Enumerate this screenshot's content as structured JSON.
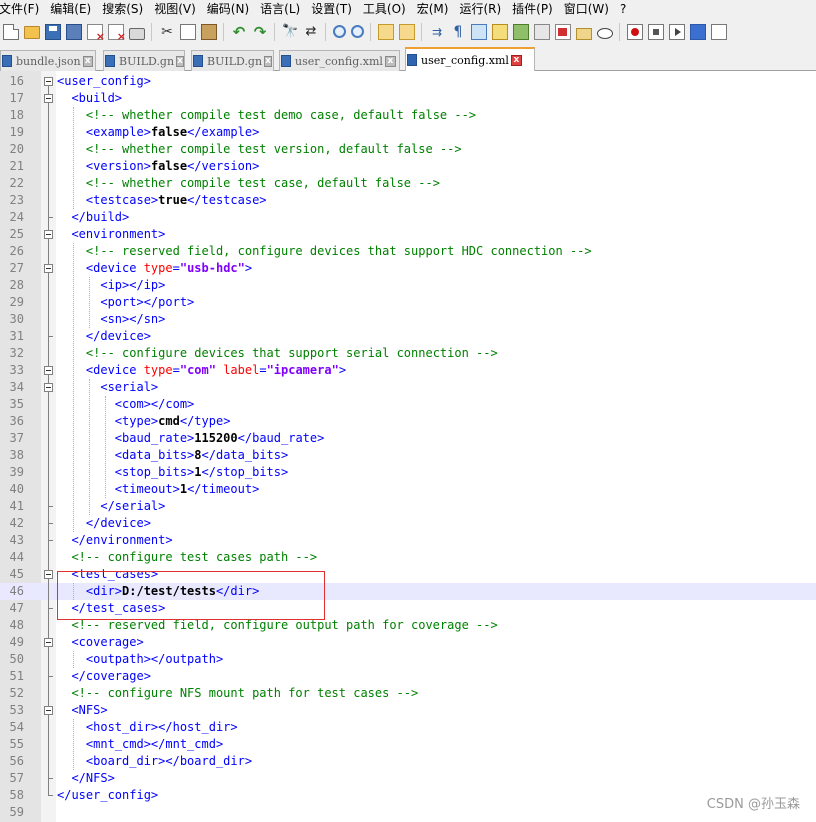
{
  "menu": [
    "文件(F)",
    "编辑(E)",
    "搜索(S)",
    "视图(V)",
    "编码(N)",
    "语言(L)",
    "设置(T)",
    "工具(O)",
    "宏(M)",
    "运行(R)",
    "插件(P)",
    "窗口(W)",
    "?"
  ],
  "tabs": [
    {
      "label": "bundle.json",
      "close": "x",
      "active": false
    },
    {
      "label": "BUILD.gn",
      "close": "x",
      "active": false
    },
    {
      "label": "BUILD.gn",
      "close": "x",
      "active": false
    },
    {
      "label": "user_config.xml",
      "close": "x",
      "active": false
    },
    {
      "label": "user_config.xml",
      "close": "x",
      "active": true
    }
  ],
  "lines": [
    {
      "n": "16",
      "html": "<span class=\"tag\">&lt;user_config&gt;</span>"
    },
    {
      "n": "17",
      "html": "  <span class=\"tag\">&lt;build&gt;</span>"
    },
    {
      "n": "18",
      "html": "    <span class=\"cmt\">&lt;!-- whether compile test demo case, default false --&gt;</span>"
    },
    {
      "n": "19",
      "html": "    <span class=\"tag\">&lt;example&gt;</span><span class=\"txt\">false</span><span class=\"tag\">&lt;/example&gt;</span>"
    },
    {
      "n": "20",
      "html": "    <span class=\"cmt\">&lt;!-- whether compile test version, default false --&gt;</span>"
    },
    {
      "n": "21",
      "html": "    <span class=\"tag\">&lt;version&gt;</span><span class=\"txt\">false</span><span class=\"tag\">&lt;/version&gt;</span>"
    },
    {
      "n": "22",
      "html": "    <span class=\"cmt\">&lt;!-- whether compile test case, default false --&gt;</span>"
    },
    {
      "n": "23",
      "html": "    <span class=\"tag\">&lt;testcase&gt;</span><span class=\"txt\">true</span><span class=\"tag\">&lt;/testcase&gt;</span>"
    },
    {
      "n": "24",
      "html": "  <span class=\"tag\">&lt;/build&gt;</span>"
    },
    {
      "n": "25",
      "html": "  <span class=\"tag\">&lt;environment&gt;</span>"
    },
    {
      "n": "26",
      "html": "    <span class=\"cmt\">&lt;!-- reserved field, configure devices that support HDC connection --&gt;</span>"
    },
    {
      "n": "27",
      "html": "    <span class=\"tag\">&lt;device </span><span class=\"attr\">type</span><span class=\"tag\">=</span><span class=\"val\">\"usb-hdc\"</span><span class=\"tag\">&gt;</span>"
    },
    {
      "n": "28",
      "html": "      <span class=\"tag\">&lt;ip&gt;&lt;/ip&gt;</span>"
    },
    {
      "n": "29",
      "html": "      <span class=\"tag\">&lt;port&gt;&lt;/port&gt;</span>"
    },
    {
      "n": "30",
      "html": "      <span class=\"tag\">&lt;sn&gt;&lt;/sn&gt;</span>"
    },
    {
      "n": "31",
      "html": "    <span class=\"tag\">&lt;/device&gt;</span>"
    },
    {
      "n": "32",
      "html": "    <span class=\"cmt\">&lt;!-- configure devices that support serial connection --&gt;</span>"
    },
    {
      "n": "33",
      "html": "    <span class=\"tag\">&lt;device </span><span class=\"attr\">type</span><span class=\"tag\">=</span><span class=\"val\">\"com\"</span> <span class=\"attr\">label</span><span class=\"tag\">=</span><span class=\"val\">\"ipcamera\"</span><span class=\"tag\">&gt;</span>"
    },
    {
      "n": "34",
      "html": "      <span class=\"tag\">&lt;serial&gt;</span>"
    },
    {
      "n": "35",
      "html": "        <span class=\"tag\">&lt;com&gt;&lt;/com&gt;</span>"
    },
    {
      "n": "36",
      "html": "        <span class=\"tag\">&lt;type&gt;</span><span class=\"txt\">cmd</span><span class=\"tag\">&lt;/type&gt;</span>"
    },
    {
      "n": "37",
      "html": "        <span class=\"tag\">&lt;baud_rate&gt;</span><span class=\"txt\">115200</span><span class=\"tag\">&lt;/baud_rate&gt;</span>"
    },
    {
      "n": "38",
      "html": "        <span class=\"tag\">&lt;data_bits&gt;</span><span class=\"txt\">8</span><span class=\"tag\">&lt;/data_bits&gt;</span>"
    },
    {
      "n": "39",
      "html": "        <span class=\"tag\">&lt;stop_bits&gt;</span><span class=\"txt\">1</span><span class=\"tag\">&lt;/stop_bits&gt;</span>"
    },
    {
      "n": "40",
      "html": "        <span class=\"tag\">&lt;timeout&gt;</span><span class=\"txt\">1</span><span class=\"tag\">&lt;/timeout&gt;</span>"
    },
    {
      "n": "41",
      "html": "      <span class=\"tag\">&lt;/serial&gt;</span>"
    },
    {
      "n": "42",
      "html": "    <span class=\"tag\">&lt;/device&gt;</span>"
    },
    {
      "n": "43",
      "html": "  <span class=\"tag\">&lt;/environment&gt;</span>"
    },
    {
      "n": "44",
      "html": "  <span class=\"cmt\">&lt;!-- configure test cases path --&gt;</span>"
    },
    {
      "n": "45",
      "html": "  <span class=\"tag\">&lt;test_cases&gt;</span>"
    },
    {
      "n": "46",
      "html": "    <span class=\"tag\">&lt;dir&gt;</span><span class=\"txt\">D:/test/tests</span><span class=\"tag\">&lt;/dir&gt;</span>",
      "current": true
    },
    {
      "n": "47",
      "html": "  <span class=\"tag\">&lt;/test_cases&gt;</span>"
    },
    {
      "n": "48",
      "html": "  <span class=\"cmt\">&lt;!-- reserved field, configure output path for coverage --&gt;</span>"
    },
    {
      "n": "49",
      "html": "  <span class=\"tag\">&lt;coverage&gt;</span>"
    },
    {
      "n": "50",
      "html": "    <span class=\"tag\">&lt;outpath&gt;&lt;/outpath&gt;</span>"
    },
    {
      "n": "51",
      "html": "  <span class=\"tag\">&lt;/coverage&gt;</span>"
    },
    {
      "n": "52",
      "html": "  <span class=\"cmt\">&lt;!-- configure NFS mount path for test cases --&gt;</span>"
    },
    {
      "n": "53",
      "html": "  <span class=\"tag\">&lt;NFS&gt;</span>"
    },
    {
      "n": "54",
      "html": "    <span class=\"tag\">&lt;host_dir&gt;&lt;/host_dir&gt;</span>"
    },
    {
      "n": "55",
      "html": "    <span class=\"tag\">&lt;mnt_cmd&gt;&lt;/mnt_cmd&gt;</span>"
    },
    {
      "n": "56",
      "html": "    <span class=\"tag\">&lt;board_dir&gt;&lt;/board_dir&gt;</span>"
    },
    {
      "n": "57",
      "html": "  <span class=\"tag\">&lt;/NFS&gt;</span>"
    },
    {
      "n": "58",
      "html": "<span class=\"tag\">&lt;/user_config&gt;</span>"
    },
    {
      "n": "59",
      "html": ""
    }
  ],
  "watermark": "CSDN @孙玉森"
}
